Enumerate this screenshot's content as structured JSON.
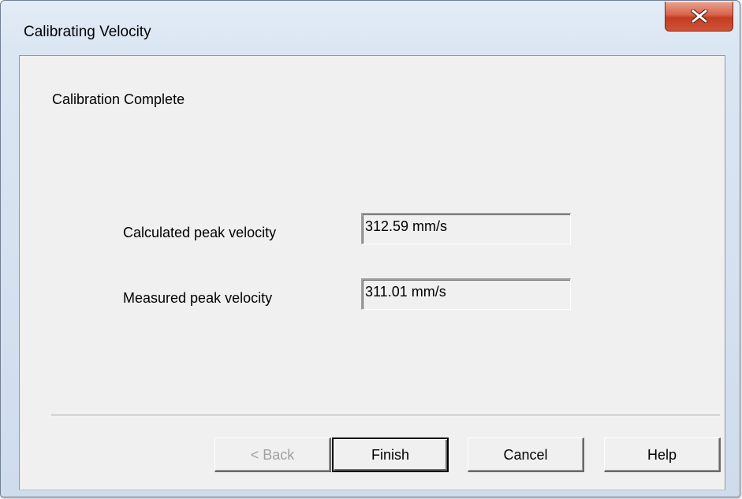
{
  "window": {
    "title": "Calibrating Velocity",
    "close_icon": "close-x-icon"
  },
  "content": {
    "heading": "Calibration Complete",
    "fields": [
      {
        "label": "Calculated peak velocity",
        "value": "312.59 mm/s"
      },
      {
        "label": "Measured peak velocity",
        "value": "311.01 mm/s"
      }
    ]
  },
  "buttons": {
    "back": {
      "label": "< Back",
      "enabled": false
    },
    "finish": {
      "label": "Finish",
      "default": true
    },
    "cancel": {
      "label": "Cancel"
    },
    "help": {
      "label": "Help"
    }
  },
  "colors": {
    "close_button": "#c94a2f",
    "dialog_face": "#f0f0f0",
    "frame": "#dbe6f3"
  }
}
